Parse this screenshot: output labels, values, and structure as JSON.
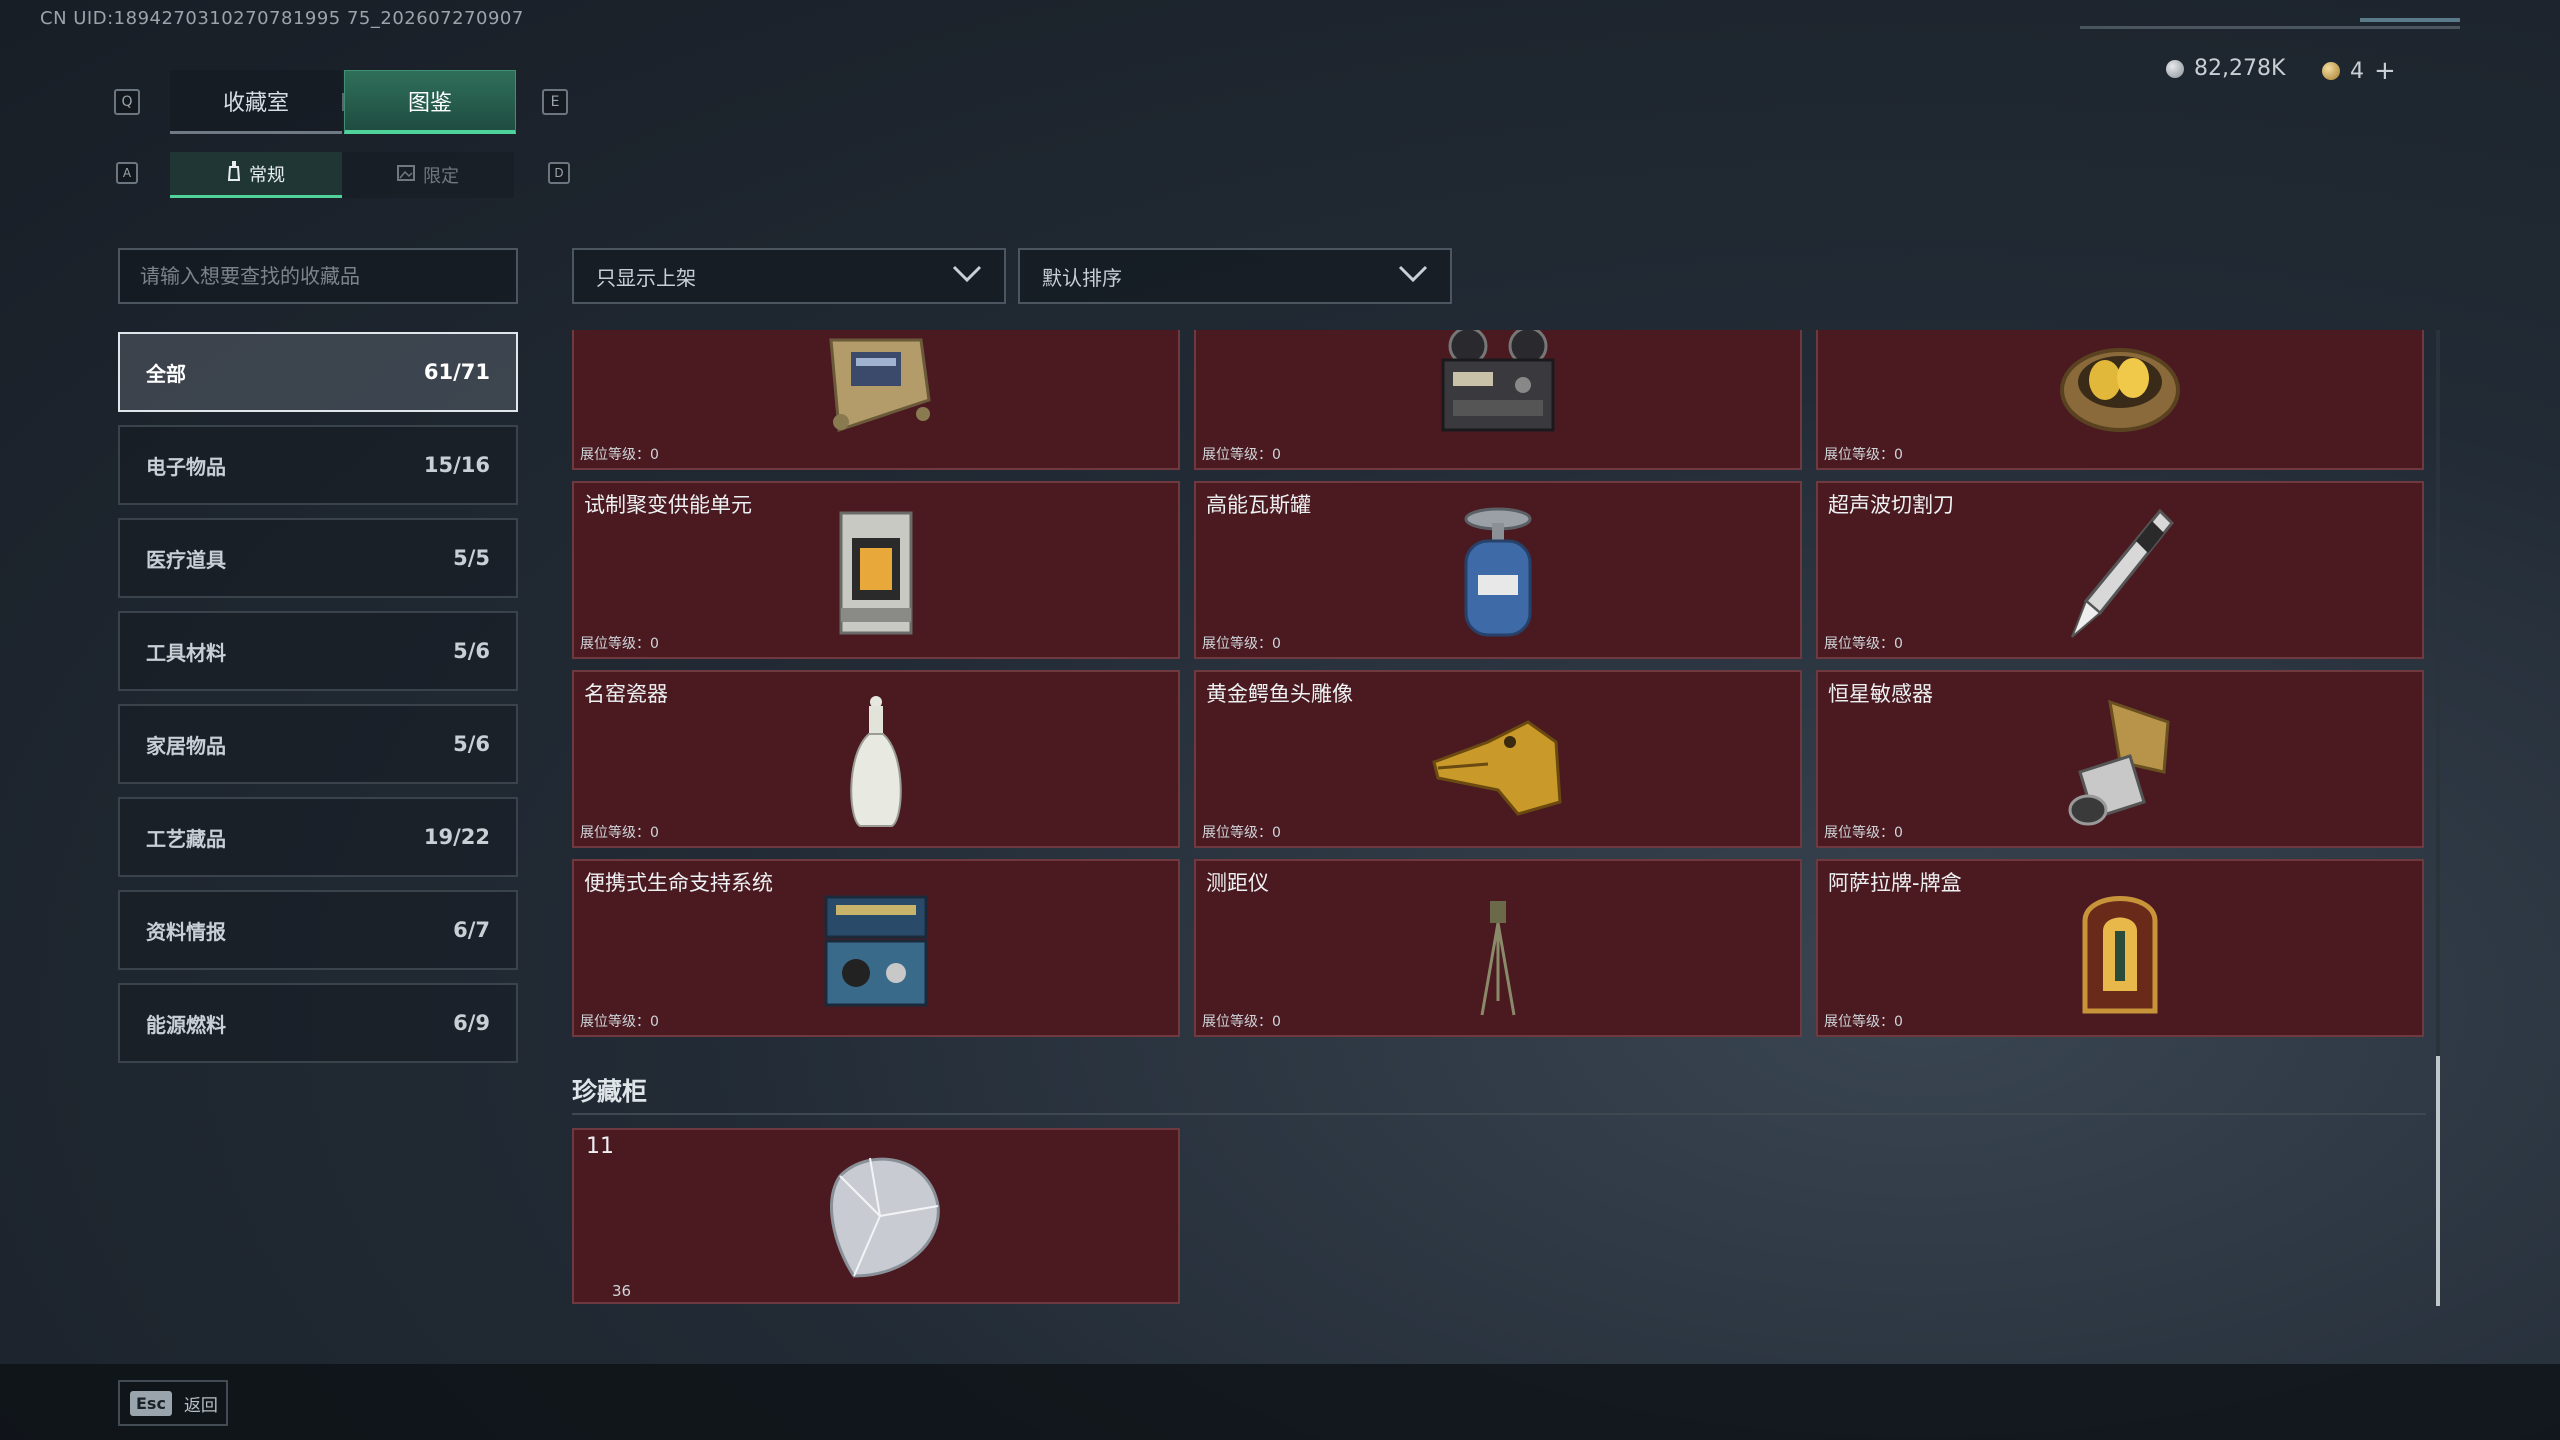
{
  "header": {
    "uid": "CN UID:1894270310270781995 75_202607270907",
    "key_q": "Q",
    "key_e": "E",
    "key_a": "A",
    "key_d": "D"
  },
  "main_tabs": [
    {
      "label": "收藏室",
      "active": false
    },
    {
      "label": "图鉴",
      "active": true
    }
  ],
  "sub_tabs": [
    {
      "label": "常规",
      "icon": "bottle-icon",
      "active": true
    },
    {
      "label": "限定",
      "icon": "image-icon",
      "active": false
    }
  ],
  "currency": {
    "silver": "82,278K",
    "gold": "4",
    "add_label": "+"
  },
  "search": {
    "placeholder": "请输入想要查找的收藏品"
  },
  "categories": [
    {
      "label": "全部",
      "count": "61/71",
      "active": true
    },
    {
      "label": "电子物品",
      "count": "15/16"
    },
    {
      "label": "医疗道具",
      "count": "5/5"
    },
    {
      "label": "工具材料",
      "count": "5/6"
    },
    {
      "label": "家居物品",
      "count": "5/6"
    },
    {
      "label": "工艺藏品",
      "count": "19/22"
    },
    {
      "label": "资料情报",
      "count": "6/7"
    },
    {
      "label": "能源燃料",
      "count": "6/9"
    }
  ],
  "filters": {
    "shelf_filter": "只显示上架",
    "sort": "默认排序"
  },
  "level_label": "展位等级：0",
  "items": [
    {
      "name": "",
      "icon": "device-icon"
    },
    {
      "name": "",
      "icon": "reel-recorder-icon"
    },
    {
      "name": "",
      "icon": "golden-eggs-nest-icon"
    },
    {
      "name": "试制聚变供能单元",
      "icon": "fusion-unit-icon"
    },
    {
      "name": "高能瓦斯罐",
      "icon": "gas-canister-icon"
    },
    {
      "name": "超声波切割刀",
      "icon": "ultrasonic-knife-icon"
    },
    {
      "name": "名窑瓷器",
      "icon": "porcelain-vase-icon"
    },
    {
      "name": "黄金鳄鱼头雕像",
      "icon": "golden-crocodile-icon"
    },
    {
      "name": "恒星敏感器",
      "icon": "star-sensor-icon"
    },
    {
      "name": "便携式生命支持系统",
      "icon": "life-support-icon"
    },
    {
      "name": "测距仪",
      "icon": "rangefinder-icon"
    },
    {
      "name": "阿萨拉牌-牌盒",
      "icon": "card-box-icon"
    }
  ],
  "treasure": {
    "section_title": "珍藏柜",
    "number": "11",
    "count": "36",
    "icon": "diamond-icon"
  },
  "footer": {
    "esc_key": "Esc",
    "back_label": "返回"
  },
  "colors": {
    "accent_green": "#4fd39b",
    "card_bg": "#4a1a20",
    "card_border": "#6e3a40"
  }
}
